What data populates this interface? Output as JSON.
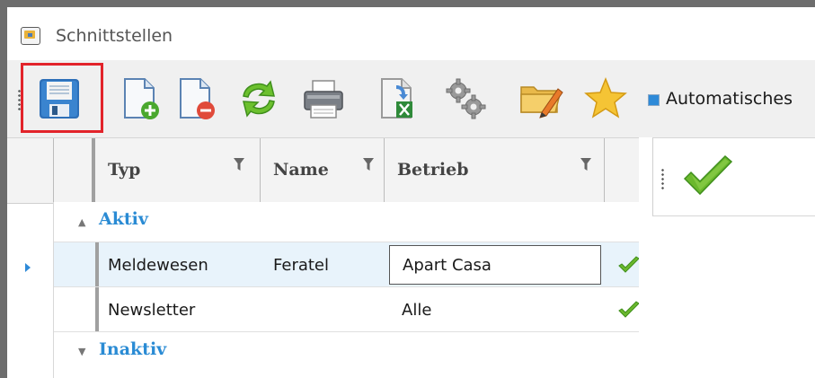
{
  "window": {
    "title": "Schnittstellen"
  },
  "toolbar": {
    "buttons": [
      {
        "id": "save",
        "icon": "save-icon"
      },
      {
        "id": "add",
        "icon": "add-document-icon"
      },
      {
        "id": "remove",
        "icon": "remove-document-icon"
      },
      {
        "id": "refresh",
        "icon": "refresh-icon"
      },
      {
        "id": "print",
        "icon": "print-icon"
      },
      {
        "id": "export-excel",
        "icon": "excel-export-icon"
      },
      {
        "id": "settings",
        "icon": "gears-icon"
      },
      {
        "id": "folder-edit",
        "icon": "folder-edit-icon"
      },
      {
        "id": "favorite",
        "icon": "star-icon"
      }
    ],
    "auto_label": "Automatisches"
  },
  "grid": {
    "columns": [
      {
        "label": "Typ"
      },
      {
        "label": "Name"
      },
      {
        "label": "Betrieb"
      }
    ],
    "groups": [
      {
        "label": "Aktiv",
        "expanded": true,
        "rows": [
          {
            "typ": "Meldewesen",
            "name": "Feratel",
            "betrieb": "Apart Casa",
            "status": "check",
            "selected": true
          },
          {
            "typ": "Newsletter",
            "name": "",
            "betrieb": "Alle",
            "status": "check",
            "selected": false
          }
        ]
      },
      {
        "label": "Inaktiv",
        "expanded": false,
        "rows": []
      }
    ]
  },
  "colors": {
    "group_label": "#2a8bd4",
    "highlight": "#e2232a",
    "check": "#6bb82d"
  }
}
